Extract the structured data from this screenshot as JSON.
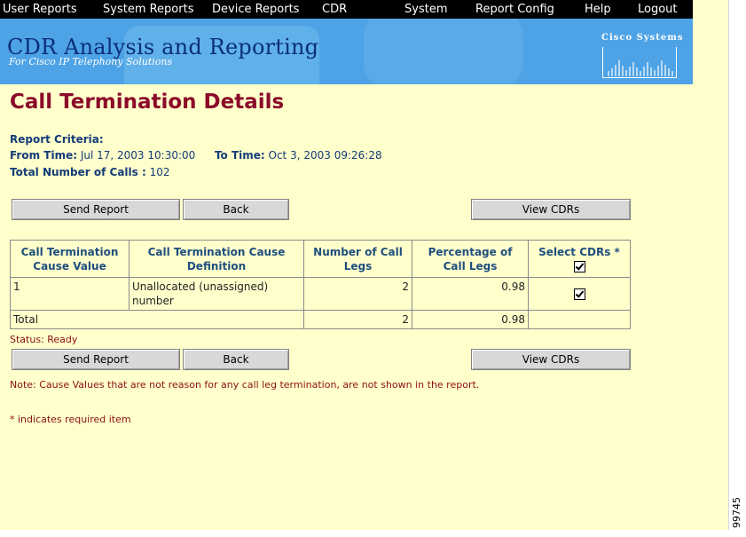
{
  "menu": [
    "User Reports",
    "System Reports",
    "Device Reports",
    "CDR",
    "System",
    "Report Config",
    "Help",
    "Logout"
  ],
  "banner": {
    "title": "CDR Analysis and Reporting",
    "subtitle": "For Cisco IP Telephony Solutions",
    "logo": "Cisco Systems"
  },
  "page_title": "Call Termination Details",
  "criteria": {
    "heading": "Report Criteria:",
    "from_label": "From Time:",
    "from_value": " Jul 17, 2003 10:30:00",
    "to_label": "To Time:",
    "to_value": " Oct 3, 2003 09:26:28",
    "total_label": "Total Number of Calls :",
    "total_value": " 102"
  },
  "buttons": {
    "send_report": "Send Report",
    "back": "Back",
    "view_cdrs": "View CDRs"
  },
  "table": {
    "headers": [
      "Call Termination Cause Value",
      "Call Termination Cause Definition",
      "Number of Call Legs",
      "Percentage of Call Legs",
      "Select CDRs *"
    ],
    "rows": [
      {
        "cause_value": "1",
        "definition": "Unallocated (unassigned) number",
        "legs": "2",
        "percentage": "0.98",
        "selected": true
      }
    ],
    "total": {
      "label": "Total",
      "legs": "2",
      "percentage": "0.98"
    }
  },
  "status": "Status: Ready",
  "note": "Note: Cause Values that are not reason for any call leg termination, are not shown in the report.",
  "required_note": "* indicates required item",
  "figure_id": "99745",
  "colors": {
    "title": "#8b0a2a",
    "banner": "#4ea3e6",
    "background": "#ffffcc"
  }
}
